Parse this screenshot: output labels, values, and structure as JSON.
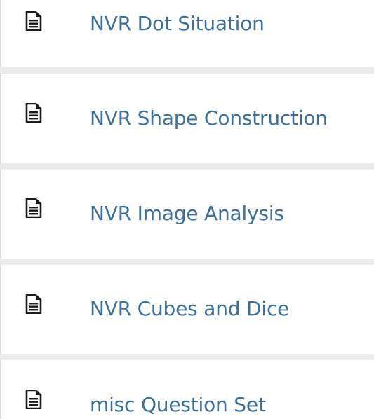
{
  "items": [
    {
      "label": "NVR Dot Situation",
      "icon": "document-icon"
    },
    {
      "label": "NVR Shape Construction",
      "icon": "document-icon"
    },
    {
      "label": "NVR Image Analysis",
      "icon": "document-icon"
    },
    {
      "label": "NVR Cubes and Dice",
      "icon": "document-icon"
    },
    {
      "label": "misc Question Set",
      "icon": "document-icon"
    }
  ],
  "colors": {
    "link": "#3d6f99",
    "icon": "#1a1a1a",
    "divider": "#ebebeb"
  }
}
